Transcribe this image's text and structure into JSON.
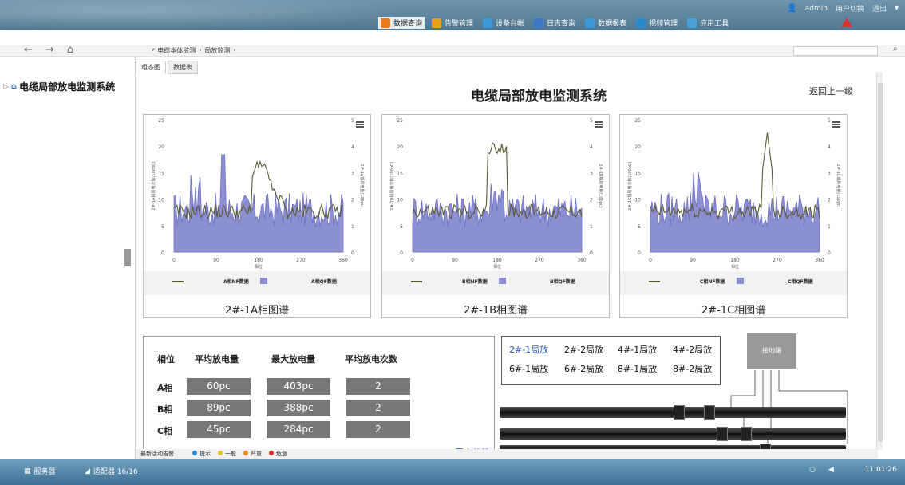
{
  "header": {
    "user": "admin",
    "switch_user": "用户切换",
    "logout": "退出",
    "nav": [
      {
        "label": "数据查询",
        "icon": "search-data-icon",
        "color": "#e87a1a",
        "active": true
      },
      {
        "label": "告警管理",
        "icon": "alarm-icon",
        "color": "#e8a11a"
      },
      {
        "label": "设备台帐",
        "icon": "device-ledger-icon",
        "color": "#3a9ad9"
      },
      {
        "label": "日志查询",
        "icon": "log-icon",
        "color": "#3a78c9"
      },
      {
        "label": "数据报表",
        "icon": "report-icon",
        "color": "#3a9ad9"
      },
      {
        "label": "视频管理",
        "icon": "video-icon",
        "color": "#2a8ad0"
      },
      {
        "label": "应用工具",
        "icon": "tools-icon",
        "color": "#4aa0d8"
      }
    ]
  },
  "breadcrumb": {
    "item1": "电缆本体监测",
    "item2": "局放监测"
  },
  "tree": {
    "root": "电缆局部放电监测系统"
  },
  "tabs": {
    "tab1": "组态图",
    "tab2": "数据表"
  },
  "page": {
    "title": "电缆局部放电监测系统",
    "back": "返回上一级"
  },
  "charts": {
    "left_axis_label_prefix": "相位",
    "panels": [
      {
        "caption": "2#-1A相图谱",
        "ylabel_left": "2#-1A相局电次数(100pC)",
        "ylabel_right": "2#-1A相局电量(100pc)",
        "legend_nf": "A相NF数据",
        "legend_qf": "A相QF数据",
        "xlabel": "相位"
      },
      {
        "caption": "2#-1B相图谱",
        "ylabel_left": "2#-1B相局电次数(100pC)",
        "ylabel_right": "2#-1B相局电量(100pc)",
        "legend_nf": "B相NF数据",
        "legend_qf": "B相QF数据",
        "xlabel": "相位"
      },
      {
        "caption": "2#-1C相图谱",
        "ylabel_left": "2#-1C相局电次数(100pC)",
        "ylabel_right": "2#-1C相局电量(100pc)",
        "legend_nf": "C相NF数据",
        "legend_qf": "C相QF数据",
        "xlabel": "相位"
      }
    ],
    "y_left_ticks": [
      "0",
      "5",
      "10",
      "15",
      "20",
      "25"
    ],
    "y_right_ticks": [
      "0",
      "1",
      "2",
      "3",
      "4",
      "5"
    ],
    "x_ticks": [
      "0",
      "90",
      "180",
      "270",
      "360"
    ],
    "colors": {
      "area": "#8c8fd0",
      "line": "#5a5a30"
    }
  },
  "stats": {
    "headers": {
      "phase": "相位",
      "avg": "平均放电量",
      "max": "最大放电量",
      "count": "平均放电次数"
    },
    "rows": [
      {
        "phase": "A相",
        "avg": "60pc",
        "max": "403pc",
        "count": "2"
      },
      {
        "phase": "B相",
        "avg": "89pc",
        "max": "388pc",
        "count": "2"
      },
      {
        "phase": "C相",
        "avg": "45pc",
        "max": "284pc",
        "count": "2"
      }
    ],
    "history_link": "历史趋势"
  },
  "positions": {
    "row1": [
      "2#-1局放",
      "2#-2局放",
      "4#-1局放",
      "4#-2局放"
    ],
    "row2": [
      "6#-1局放",
      "6#-2局放",
      "8#-1局放",
      "8#-2局放"
    ],
    "ground_box": "接地箱"
  },
  "alarm_legend": {
    "title": "最新活动告警",
    "items": [
      {
        "label": "提示",
        "color": "#2a88d8"
      },
      {
        "label": "一般",
        "color": "#e8c21a"
      },
      {
        "label": "严重",
        "color": "#e88a1a"
      },
      {
        "label": "危急",
        "color": "#d9302a"
      }
    ]
  },
  "taskbar": {
    "server": "服务器",
    "adapter": "适配器 16/16",
    "time": "11:01:26"
  }
}
